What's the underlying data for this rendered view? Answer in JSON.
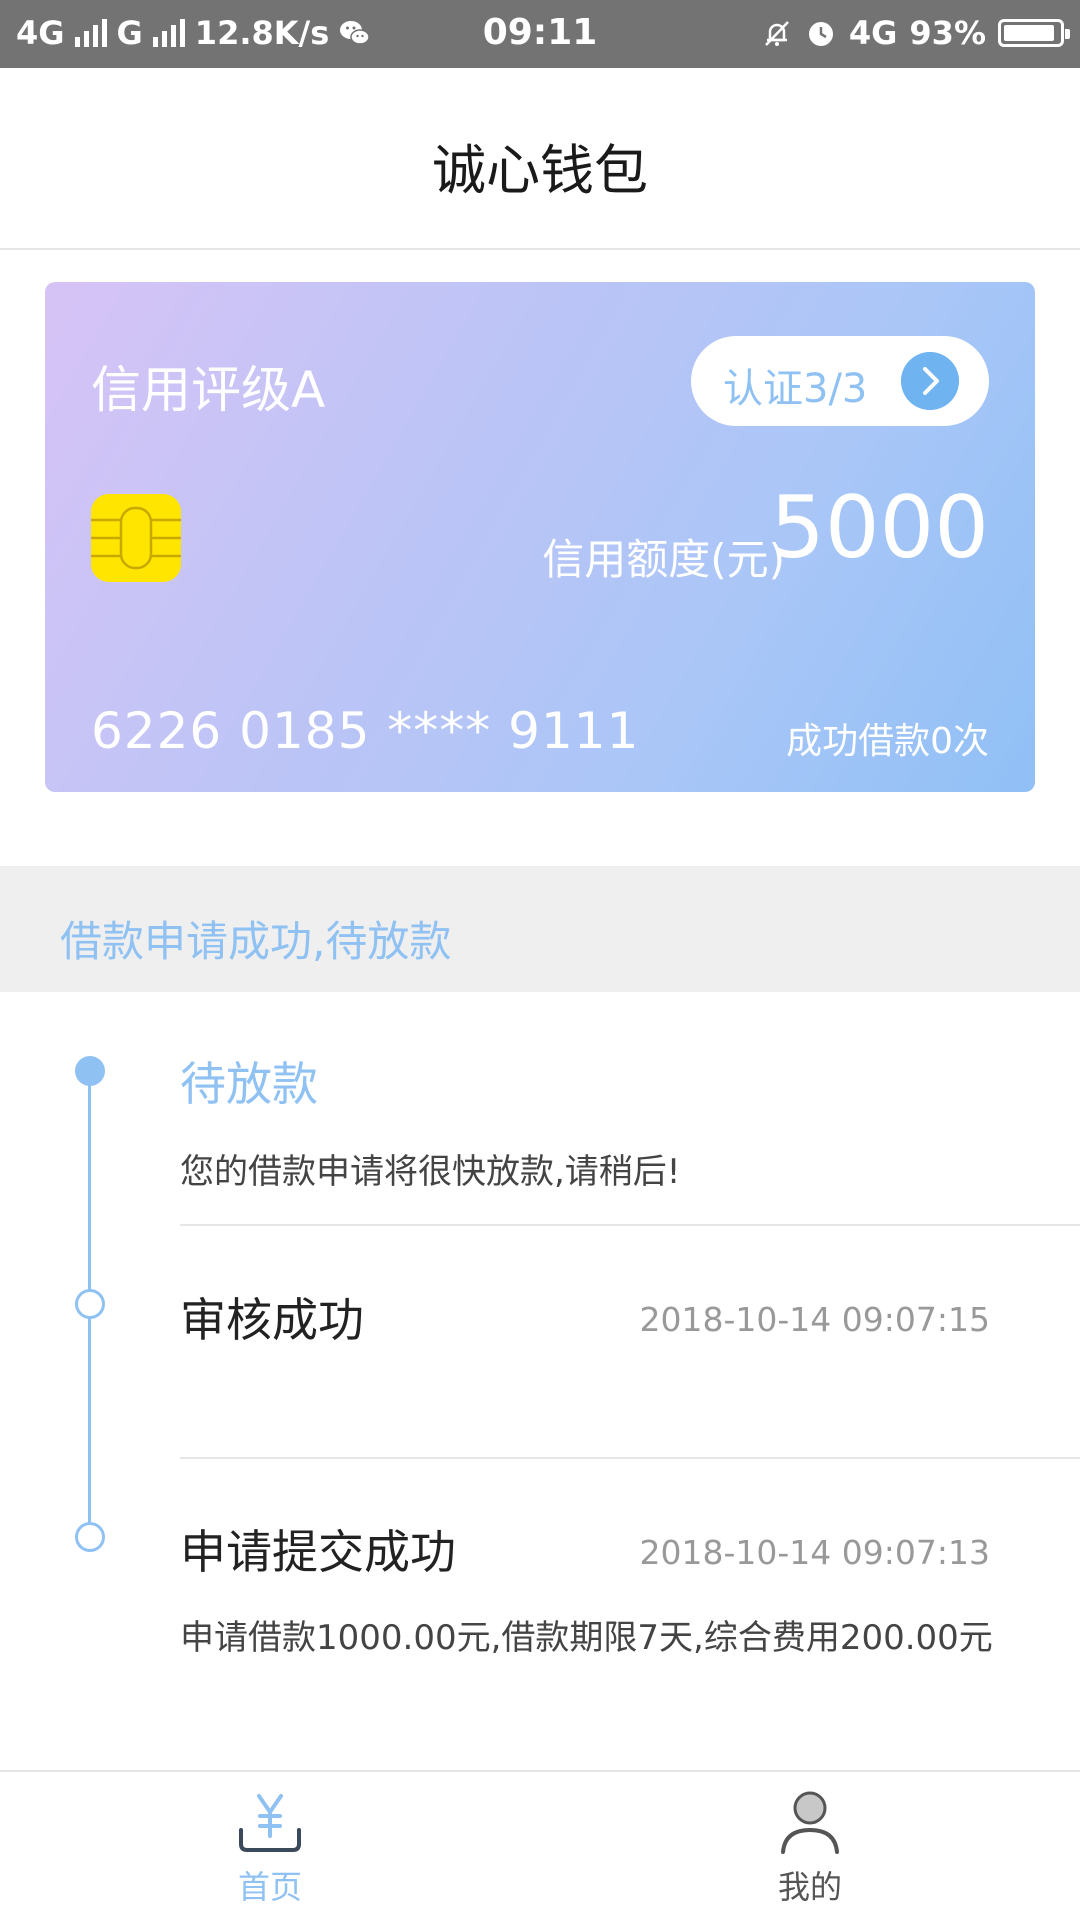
{
  "status_bar": {
    "network1": "4G",
    "network2": "G",
    "speed": "12.8K/s",
    "time": "09:11",
    "network3": "4G",
    "battery": "93%",
    "battery_level": 0.93
  },
  "header": {
    "title": "诚心钱包"
  },
  "card": {
    "rating": "信用评级A",
    "cert_label": "认证3/3",
    "limit_label": "信用额度(元)",
    "limit_value": "5000",
    "card_number": "6226 0185 **** 9111",
    "loans": "成功借款0次",
    "gradient_colors": [
      "#d7c3f6",
      "#90c0f6"
    ],
    "chip_color": "#ffe500"
  },
  "status_strip": {
    "text": "借款申请成功,待放款"
  },
  "timeline": [
    {
      "title": "待放款",
      "desc": "您的借款申请将很快放款,请稍后!",
      "time": ""
    },
    {
      "title": "审核成功",
      "desc": "",
      "time": "2018-10-14 09:07:15"
    },
    {
      "title": "申请提交成功",
      "desc": "申请借款1000.00元,借款期限7天,综合费用200.00元",
      "time": "2018-10-14 09:07:13"
    }
  ],
  "nav": {
    "home_label": "首页",
    "home_icon": "yen-icon",
    "mine_label": "我的",
    "mine_icon": "person-icon"
  },
  "colors": {
    "accent": "#8fc1f3",
    "button_arrow": "#6fb3f1"
  }
}
